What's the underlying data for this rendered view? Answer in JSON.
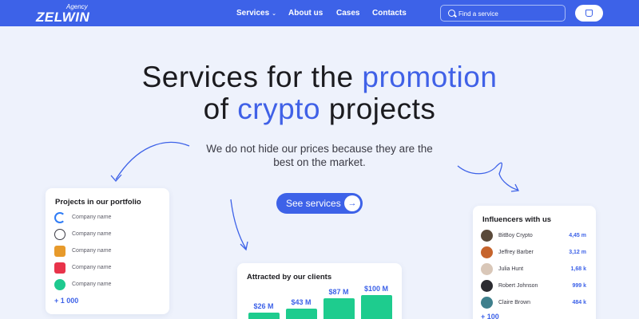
{
  "brand": {
    "agency": "Agency",
    "name": "ZELWIN"
  },
  "nav": {
    "items": [
      {
        "label": "Services",
        "has_dropdown": true
      },
      {
        "label": "About us"
      },
      {
        "label": "Cases"
      },
      {
        "label": "Contacts"
      }
    ]
  },
  "search": {
    "placeholder": "Find a service",
    "icon": "search-icon"
  },
  "cart": {
    "icon": "cart-icon"
  },
  "hero": {
    "line1_prefix": "Services for the ",
    "line1_highlight": "promotion",
    "line2_prefix": "of ",
    "line2_highlight": "crypto",
    "line2_suffix": " projects",
    "subtitle_line1": "We do not hide our prices because they are the",
    "subtitle_line2": "best on the market.",
    "cta_label": "See services",
    "cta_icon": "arrow-right-icon"
  },
  "portfolio": {
    "title": "Projects in our portfolio",
    "items": [
      {
        "name": "Company name",
        "color": "#2f7cf6"
      },
      {
        "name": "Company name",
        "color": "#3a3a44"
      },
      {
        "name": "Company name",
        "color": "#e79a2b"
      },
      {
        "name": "Company name",
        "color": "#e8334a"
      },
      {
        "name": "Company name",
        "color": "#1ec98f"
      }
    ],
    "more": "+ 1 000"
  },
  "influencers": {
    "title": "Influencers with us",
    "items": [
      {
        "name": "BitBoy Crypto",
        "count": "4,45 m"
      },
      {
        "name": "Jeffrey Barber",
        "count": "3,12 m"
      },
      {
        "name": "Julia Hunt",
        "count": "1,68 k"
      },
      {
        "name": "Robert Johnson",
        "count": "999 k"
      },
      {
        "name": "Claire Brown",
        "count": "484 k"
      }
    ],
    "more": "+ 100"
  },
  "attracted": {
    "title": "Attracted by our clients",
    "bars": [
      {
        "label": "$26 M",
        "value": 26
      },
      {
        "label": "$43 M",
        "value": 43
      },
      {
        "label": "$87 M",
        "value": 87
      },
      {
        "label": "$100 M",
        "value": 100
      }
    ]
  },
  "colors": {
    "primary": "#3d62e8",
    "accent_green": "#1ecc8e",
    "background": "#eef2fc"
  }
}
